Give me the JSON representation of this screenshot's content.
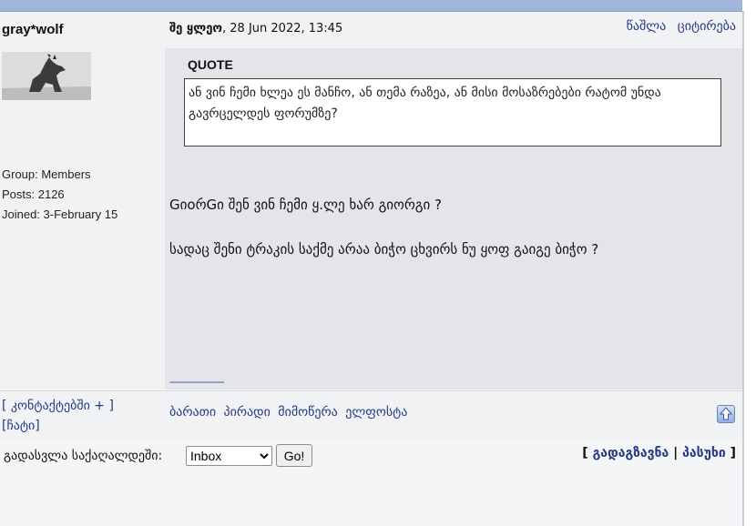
{
  "post": {
    "author": "gray*wolf",
    "sender": "შე ყლეო",
    "datetime": ", 28 Jun 2022, 13:45",
    "actions": {
      "delete": "წაშლა",
      "quote": "ციტირება"
    }
  },
  "user": {
    "group": "Group: Members",
    "posts": "Posts: 2126",
    "joined": "Joined: 3-February 15"
  },
  "quote": {
    "title": "QUOTE",
    "text": "ან ვინ ჩემი ხლეა ეს მანჩო, ან თემა რაზეა, ან მისი მოსაზრებები რატომ უნდა გავრცელდეს ფორუმზე?"
  },
  "body": {
    "line1": "GიoრGი შენ ვინ ჩემი ყ.ლე ხარ გიორგი ?",
    "line2": "სადაც შენი ტრაკის საქმე არაა ბიჭო ცხვირს ნუ ყოფ გაიგე ბიჭო ?",
    "signature": "--------------------"
  },
  "footer": {
    "contacts": "[ კონტაქტებში + ]",
    "block": "[ჩატი]",
    "links": [
      "ბარათი",
      "პირადი",
      "მიმოწერა",
      "ელფოსტა"
    ],
    "top_icon": "arrow-up-icon"
  },
  "bottom": {
    "goto_label": "გადასვლა საქაღალდეში:",
    "folder_selected": "Inbox",
    "go_label": "Go!",
    "bracket_open": "[",
    "forward": "გადაგზავნა",
    "separator": "|",
    "reply": "პასუხი",
    "bracket_close": "]"
  }
}
